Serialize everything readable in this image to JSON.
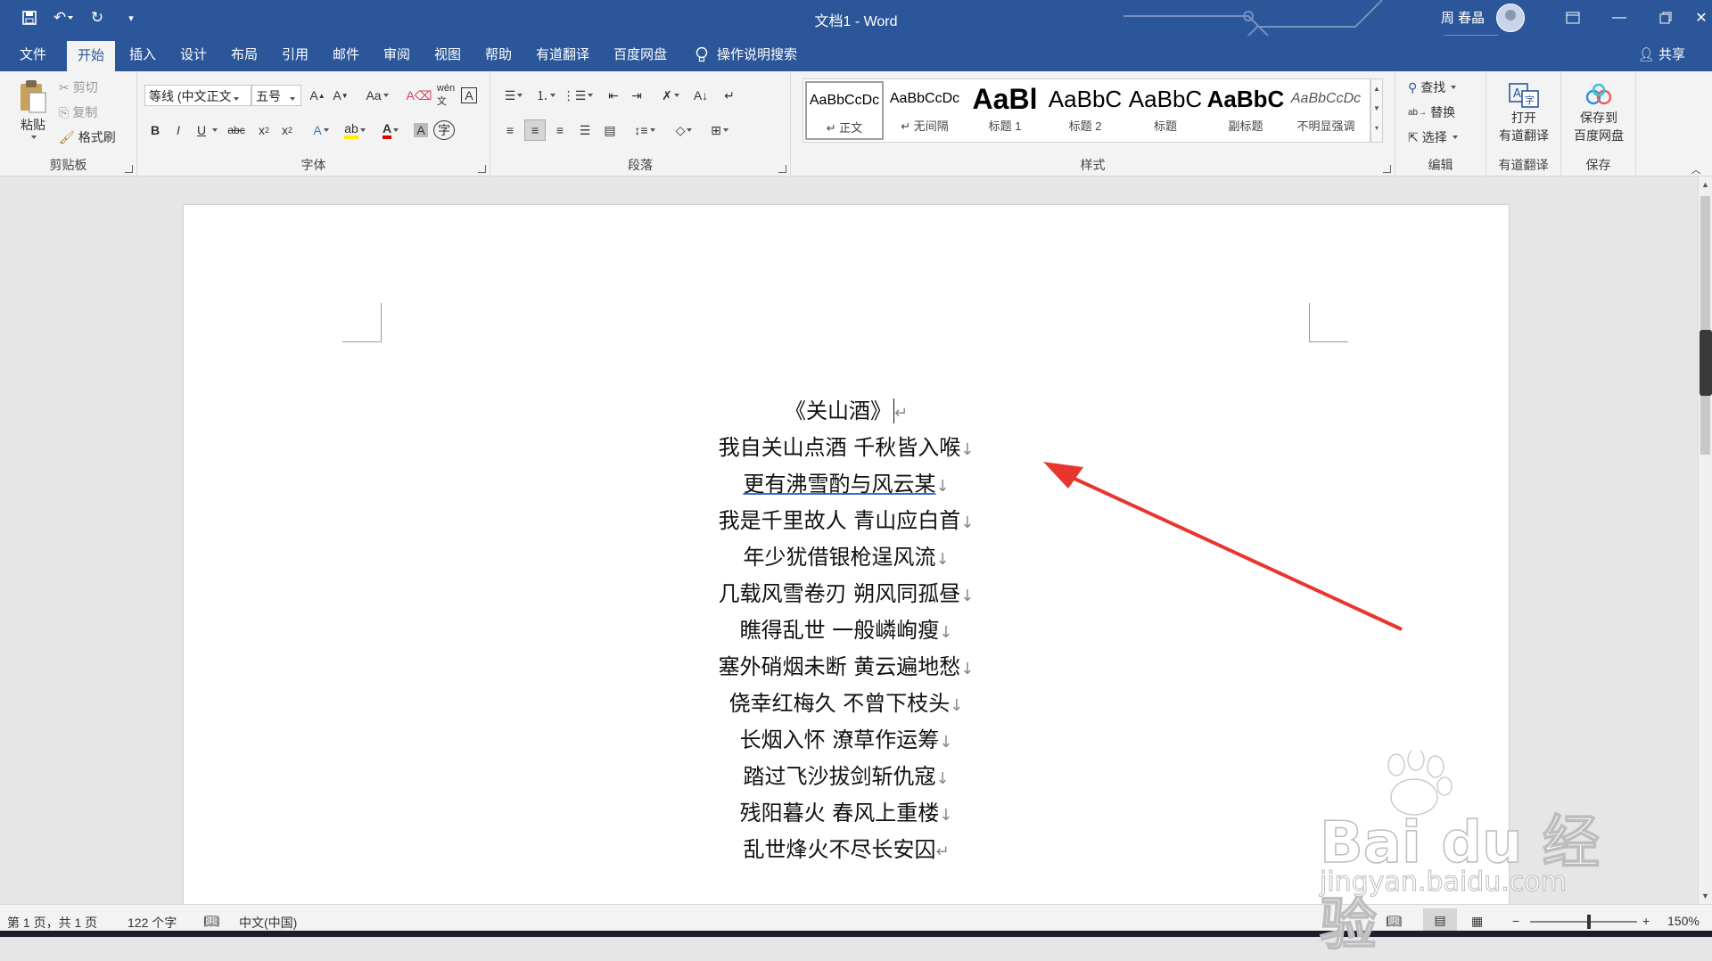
{
  "title_bar": {
    "document_title": "文档1 - Word",
    "user_name": "周 春晶"
  },
  "ribbon_tabs": [
    "文件",
    "开始",
    "插入",
    "设计",
    "布局",
    "引用",
    "邮件",
    "审阅",
    "视图",
    "帮助",
    "有道翻译",
    "百度网盘"
  ],
  "active_tab": "开始",
  "tell_me": "操作说明搜索",
  "share": "共享",
  "clipboard": {
    "paste": "粘贴",
    "cut": "剪切",
    "copy": "复制",
    "format_painter": "格式刷",
    "group_label": "剪贴板"
  },
  "font": {
    "font_name": "等线 (中文正文",
    "font_size": "五号",
    "group_label": "字体"
  },
  "paragraph": {
    "group_label": "段落"
  },
  "styles": {
    "items": [
      {
        "preview": "AaBbCcDc",
        "name": "↵ 正文"
      },
      {
        "preview": "AaBbCcDc",
        "name": "↵ 无间隔"
      },
      {
        "preview": "AaBl",
        "name": "标题 1"
      },
      {
        "preview": "AaBbC",
        "name": "标题 2"
      },
      {
        "preview": "AaBbC",
        "name": "标题"
      },
      {
        "preview": "AaBbC",
        "name": "副标题"
      },
      {
        "preview": "AaBbCcDc",
        "name": "不明显强调"
      }
    ],
    "group_label": "样式"
  },
  "editing": {
    "find": "查找",
    "replace": "替换",
    "select": "选择",
    "group_label": "编辑"
  },
  "youdao": {
    "button": "打开\n有道翻译",
    "line1": "打开",
    "line2": "有道翻译",
    "group_label": "有道翻译"
  },
  "baidu": {
    "line1": "保存到",
    "line2": "百度网盘",
    "group_label": "保存"
  },
  "document": {
    "title": "《关山酒》",
    "lines": [
      "我自关山点酒 千秋皆入喉",
      "更有沸雪酌与风云某",
      "我是千里故人 青山应白首",
      "年少犹借银枪逞风流",
      "几载风雪卷刃 朔风同孤昼",
      "瞧得乱世 一般嶙峋瘦",
      "塞外硝烟未断 黄云遍地愁",
      "侥幸红梅久 不曾下枝头",
      "长烟入怀 潦草作运筹",
      "踏过飞沙拔剑斩仇寇",
      "残阳暮火 春风上重楼",
      "乱世烽火不尽长安囚"
    ]
  },
  "status_bar": {
    "page": "第 1 页，共 1 页",
    "words": "122 个字",
    "language": "中文(中国)",
    "zoom": "150%"
  },
  "watermark": {
    "brand": "Bai du 经验",
    "url": "jingyan.baidu.com"
  },
  "colors": {
    "brand_blue": "#2b579a",
    "annotation_arrow": "#e8362f"
  }
}
